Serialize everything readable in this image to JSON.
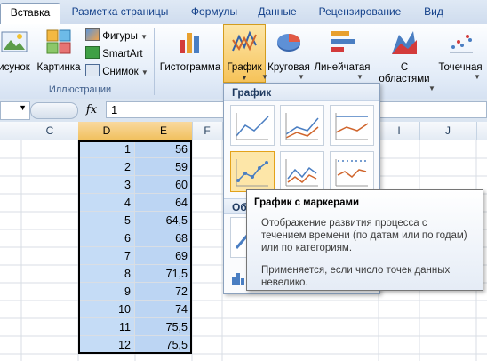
{
  "tabs": [
    "Вставка",
    "Разметка страницы",
    "Формулы",
    "Данные",
    "Рецензирование",
    "Вид"
  ],
  "ribbon": {
    "picture_label": "исунок",
    "clipart_label": "Картинка",
    "shapes_label": "Фигуры",
    "smartart_label": "SmartArt",
    "screenshot_label": "Снимок",
    "illustrations_group": "Иллюстрации",
    "histogram_label": "Гистограмма",
    "line_label": "График",
    "pie_label": "Круговая",
    "bar_label": "Линейчатая",
    "area_label_1": "С",
    "area_label_2": "областями",
    "scatter_label": "Точечная"
  },
  "formula_bar": {
    "fx": "fx",
    "value": "1"
  },
  "columns": [
    "C",
    "D",
    "E",
    "F",
    "I",
    "J"
  ],
  "rows": [
    [
      "1",
      "56"
    ],
    [
      "2",
      "59"
    ],
    [
      "3",
      "60"
    ],
    [
      "4",
      "64"
    ],
    [
      "5",
      "64,5"
    ],
    [
      "6",
      "68"
    ],
    [
      "7",
      "69"
    ],
    [
      "8",
      "71,5"
    ],
    [
      "9",
      "72"
    ],
    [
      "10",
      "74"
    ],
    [
      "11",
      "75,5"
    ],
    [
      "12",
      "75,5"
    ]
  ],
  "dropdown": {
    "header": "График",
    "section2": "Об"
  },
  "tooltip": {
    "title": "График с маркерами",
    "line1": "Отображение развития процесса с",
    "line2": "течением времени (по датам или по годам)",
    "line3": "или по категориям.",
    "line4": "Применяется, если число точек данных",
    "line5": "невелико."
  },
  "colors": {
    "selected_col": "#f1c15f",
    "cell_sel_d": "#c5dcf6",
    "cell_sel_e": "#bcd5f3",
    "accent": "#15428b"
  }
}
